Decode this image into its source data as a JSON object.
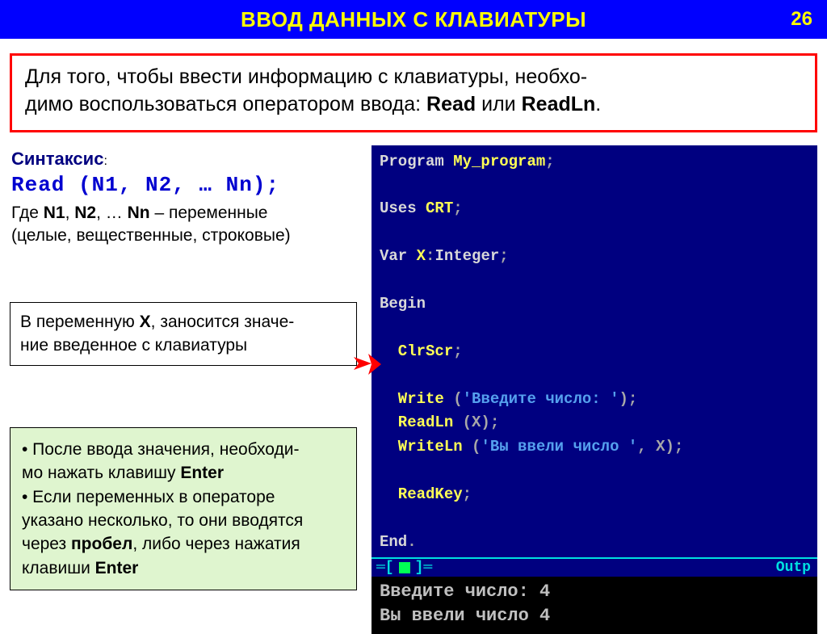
{
  "header": {
    "title": "ВВОД ДАННЫХ С КЛАВИАТУРЫ",
    "page": "26"
  },
  "intro": {
    "line1": "Для того, чтобы ввести информацию с клавиатуры, необхо-",
    "line2a": "димо воспользоваться оператором ввода: ",
    "read": "Read",
    "or": " или ",
    "readln": "ReadLn",
    "period": "."
  },
  "syntax": {
    "label": "Синтаксис",
    "colon": ":",
    "code": "Read (N1, N2, … Nn);",
    "where": "Где ",
    "n1": "N1",
    "c1": ", ",
    "n2": "N2",
    "c2": ", … ",
    "nn": "Nn",
    "tail": " – переменные",
    "paren": "(целые, вещественные, строковые)"
  },
  "note": {
    "p1a": "В переменную ",
    "x": "X",
    "p1b": ", заносится значе-",
    "p2": "ние введенное с клавиатуры"
  },
  "tips": {
    "b1a": "• После ввода значения, необходи-",
    "b1b": "мо нажать клавишу ",
    "enter1": "Enter",
    "b2a": "• Если переменных в операторе",
    "b2b": "указано несколько, то они вводятся",
    "b2c": "через ",
    "space": "пробел",
    "b2d": ", либо через нажатия",
    "b2e": "клавиши ",
    "enter2": "Enter"
  },
  "code": {
    "l1a": "Program",
    "l1b": " My_program",
    "l1c": ";",
    "l2a": "Uses",
    "l2b": " CRT",
    "l2c": ";",
    "l3a": "Var",
    "l3b": " X",
    "l3c": ":",
    "l3d": "Integer",
    "l3e": ";",
    "l4": "Begin",
    "l5a": "  ClrScr",
    "l5b": ";",
    "l6a": "  Write",
    "l6b": " (",
    "l6c": "'Введите число: '",
    "l6d": ");",
    "l7a": "  ReadLn",
    "l7b": " (X);",
    "l8a": "  WriteLn",
    "l8b": " (",
    "l8c": "'Вы ввели число '",
    "l8d": ", X);",
    "l9a": "  ReadKey",
    "l9b": ";",
    "l10a": "End",
    "l10b": "."
  },
  "outputbar": {
    "l": "═[",
    "r": "]═",
    "label": "Outp"
  },
  "console": {
    "line1": "Введите число: 4",
    "line2": "Вы ввели число 4"
  }
}
